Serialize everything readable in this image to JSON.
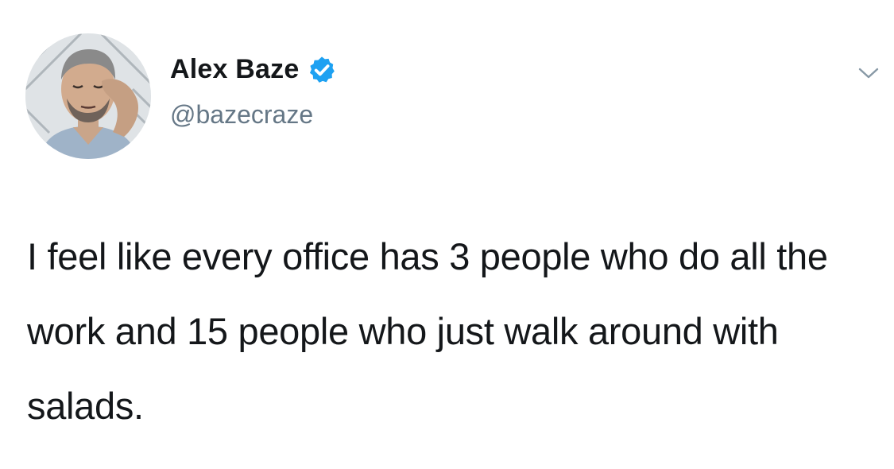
{
  "tweet": {
    "author": {
      "display_name": "Alex Baze",
      "handle": "@bazecraze",
      "verified": true
    },
    "text": "I feel like every office has 3 people who do all the work and 15 people who just walk around with salads.",
    "icons": {
      "avatar": "profile-photo",
      "verified": "verified-badge-icon",
      "more": "chevron-down-icon"
    },
    "colors": {
      "verified_badge": "#1da1f2",
      "name": "#14171a",
      "handle": "#657786",
      "text": "#14171a"
    }
  }
}
